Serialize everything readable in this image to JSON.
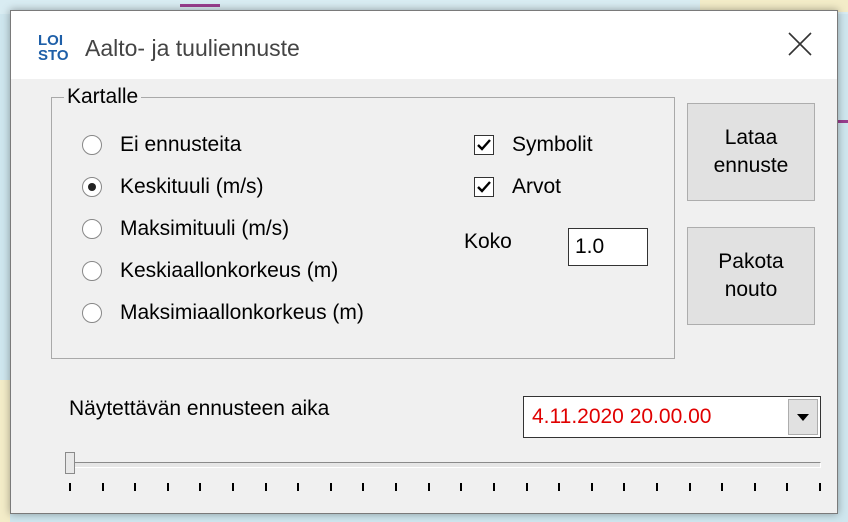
{
  "window": {
    "logo_line1": "LOI",
    "logo_line2": "STO",
    "title": "Aalto- ja tuuliennuste",
    "close_icon": "close-icon"
  },
  "kartalle": {
    "legend": "Kartalle",
    "options": [
      {
        "label": "Ei ennusteita",
        "checked": false
      },
      {
        "label": "Keskituuli (m/s)",
        "checked": true
      },
      {
        "label": "Maksimituuli (m/s)",
        "checked": false
      },
      {
        "label": "Keskiaallonkorkeus (m)",
        "checked": false
      },
      {
        "label": "Maksimiaallonkorkeus  (m)",
        "checked": false
      }
    ],
    "symbolit_label": "Symbolit",
    "symbolit_checked": true,
    "arvot_label": "Arvot",
    "arvot_checked": true,
    "koko_label": "Koko",
    "koko_value": "1.0"
  },
  "buttons": {
    "lataa": "Lataa\nennuste",
    "pakota": "Pakota\nnouto"
  },
  "time": {
    "label": "Näytettävän ennusteen aika",
    "value": "4.11.2020 20.00.00",
    "value_color": "#e00000"
  },
  "slider": {
    "position": 0,
    "tick_count": 24
  }
}
